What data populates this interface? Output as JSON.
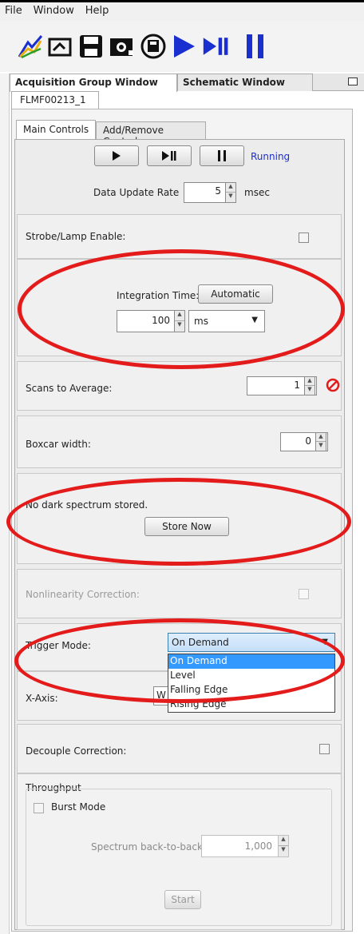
{
  "menu": {
    "items": [
      "File",
      "Window",
      "Help"
    ]
  },
  "toolbar": {
    "icons": [
      "spectrum-wizard-icon",
      "open-icon",
      "save-icon",
      "camera-icon",
      "disk-icon",
      "play-icon",
      "step-icon",
      "pause-icon"
    ]
  },
  "window_tabs": {
    "acquisition": "Acquisition Group Window",
    "schematic": "Schematic Window"
  },
  "device_tab": "FLMF00213_1",
  "control_tabs": {
    "main": "Main Controls",
    "add_remove": "Add/Remove Controls"
  },
  "acquisition": {
    "status": "Running",
    "rate_label": "Data Update Rate",
    "rate_value": "5",
    "rate_unit": "msec"
  },
  "strobe": {
    "label": "Strobe/Lamp Enable:"
  },
  "integration": {
    "label": "Integration Time:",
    "auto_button": "Automatic",
    "value": "100",
    "unit": "ms"
  },
  "scans": {
    "label": "Scans to Average:",
    "value": "1"
  },
  "boxcar": {
    "label": "Boxcar width:",
    "value": "0"
  },
  "dark": {
    "message": "No dark spectrum stored.",
    "button": "Store Now"
  },
  "nonlinearity": {
    "label": "Nonlinearity Correction:"
  },
  "trigger": {
    "label": "Trigger Mode:",
    "selected": "On Demand",
    "options": [
      "On Demand",
      "Level",
      "Falling Edge",
      "Rising Edge"
    ]
  },
  "xaxis": {
    "label": "X-Axis:",
    "value_partial": "W"
  },
  "decouple": {
    "label": "Decouple Correction:"
  },
  "throughput": {
    "title": "Throughput",
    "burst_label": "Burst Mode",
    "b2b_label": "Spectrum back-to-back",
    "b2b_value": "1,000",
    "start_button": "Start"
  },
  "colors": {
    "accent_red": "#e31b1b",
    "status_blue": "#1a2fd0",
    "selection_blue": "#3399ff",
    "toolbar_blue": "#1a2fd0"
  }
}
